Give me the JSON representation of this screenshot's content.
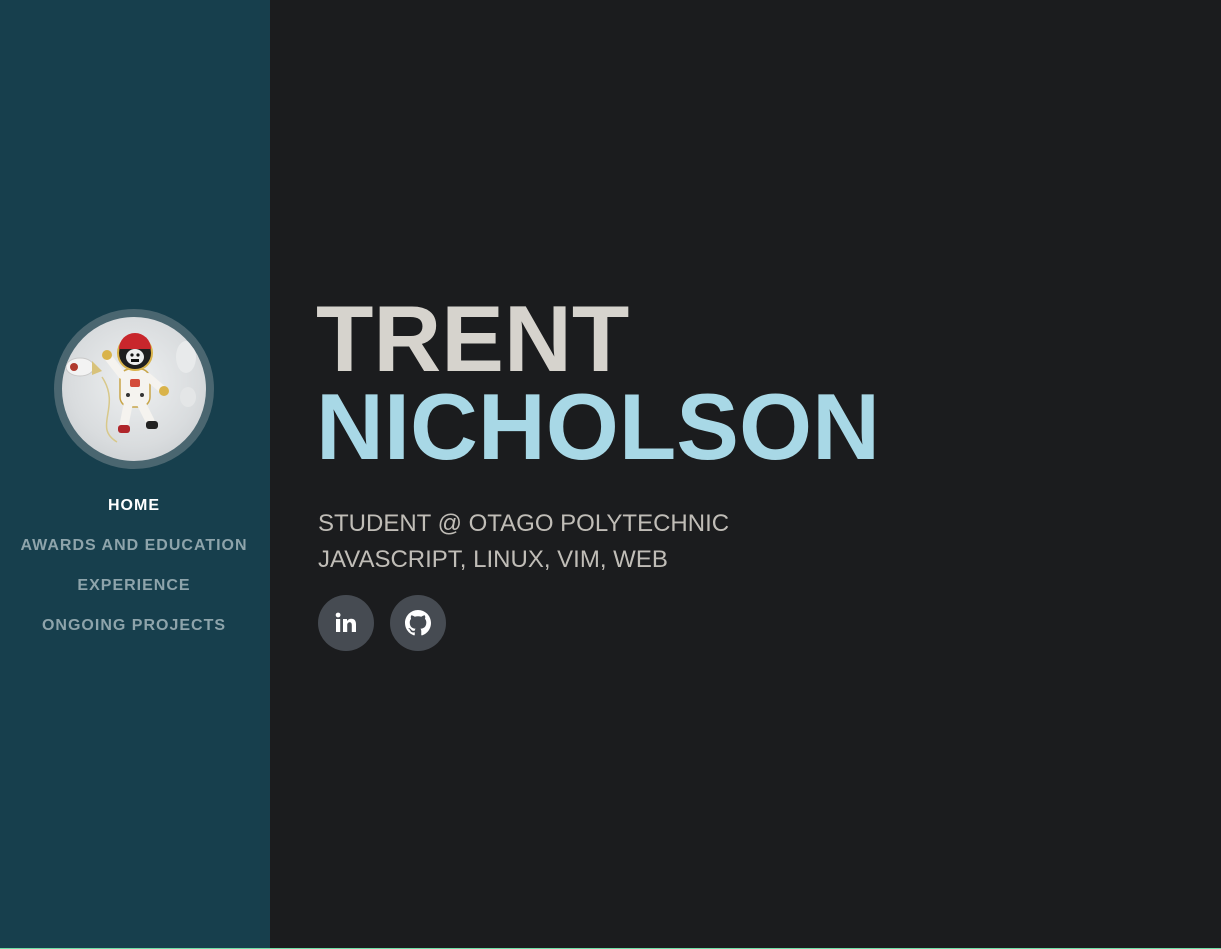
{
  "sidebar": {
    "avatar_alt": "astronaut avatar",
    "nav": [
      {
        "label": "HOME",
        "active": true
      },
      {
        "label": "AWARDS AND EDUCATION",
        "active": false
      },
      {
        "label": "EXPERIENCE",
        "active": false
      },
      {
        "label": "ONGOING PROJECTS",
        "active": false
      }
    ]
  },
  "hero": {
    "first_name": "TRENT",
    "last_name": "NICHOLSON",
    "subtitle_line1": "STUDENT @ OTAGO POLYTECHNIC",
    "subtitle_line2": "JAVASCRIPT, LINUX, VIM, WEB"
  },
  "social": {
    "linkedin_icon": "linkedin-icon",
    "github_icon": "github-icon"
  },
  "colors": {
    "sidebar_bg": "#173f4d",
    "main_bg": "#1b1c1e",
    "first_name": "#d6d3cd",
    "last_name": "#a8d8e6",
    "nav_active": "#ffffff",
    "nav_inactive": "#8ea4ab",
    "social_bg": "#464b52"
  }
}
